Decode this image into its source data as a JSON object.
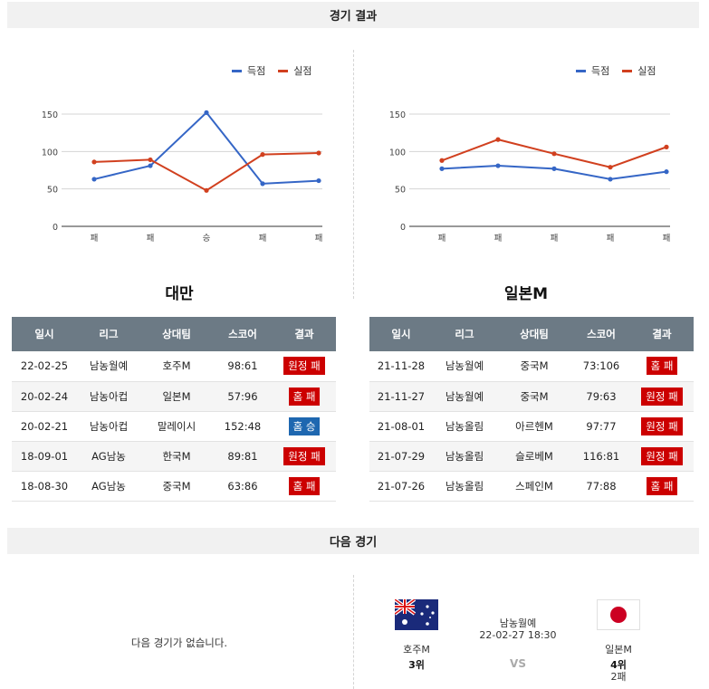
{
  "sections": {
    "results_title": "경기 결과",
    "next_title": "다음 경기"
  },
  "colors": {
    "scored": "#3566c6",
    "conceded": "#d1401f",
    "loss_badge": "#cc0000",
    "win_badge": "#1e67b0",
    "header_bg": "#6c7a85"
  },
  "legend": {
    "scored": "득점",
    "conceded": "실점"
  },
  "chart_data": [
    {
      "type": "line",
      "categories": [
        "패",
        "패",
        "승",
        "패",
        "패"
      ],
      "ylim": [
        0,
        150
      ],
      "yticks": [
        0,
        50,
        100,
        150
      ],
      "grid": true,
      "legend_position": "top-right",
      "series": [
        {
          "name": "득점",
          "values": [
            63,
            81,
            152,
            57,
            61
          ]
        },
        {
          "name": "실점",
          "values": [
            86,
            89,
            48,
            96,
            98
          ]
        }
      ]
    },
    {
      "type": "line",
      "categories": [
        "패",
        "패",
        "패",
        "패",
        "패"
      ],
      "ylim": [
        0,
        150
      ],
      "yticks": [
        0,
        50,
        100,
        150
      ],
      "grid": true,
      "legend_position": "top-right",
      "series": [
        {
          "name": "득점",
          "values": [
            77,
            81,
            77,
            63,
            73
          ]
        },
        {
          "name": "실점",
          "values": [
            88,
            116,
            97,
            79,
            106
          ]
        }
      ]
    }
  ],
  "teams": [
    {
      "name": "대만",
      "columns": [
        "일시",
        "리그",
        "상대팀",
        "스코어",
        "결과"
      ],
      "rows": [
        {
          "date": "22-02-25",
          "league": "남농월예",
          "opponent": "호주M",
          "score": "98:61",
          "result": "원정 패",
          "win": false
        },
        {
          "date": "20-02-24",
          "league": "남농아컵",
          "opponent": "일본M",
          "score": "57:96",
          "result": "홈 패",
          "win": false
        },
        {
          "date": "20-02-21",
          "league": "남농아컵",
          "opponent": "말레이시",
          "score": "152:48",
          "result": "홈 승",
          "win": true
        },
        {
          "date": "18-09-01",
          "league": "AG남농",
          "opponent": "한국M",
          "score": "89:81",
          "result": "원정 패",
          "win": false
        },
        {
          "date": "18-08-30",
          "league": "AG남농",
          "opponent": "중국M",
          "score": "63:86",
          "result": "홈 패",
          "win": false
        }
      ]
    },
    {
      "name": "일본M",
      "columns": [
        "일시",
        "리그",
        "상대팀",
        "스코어",
        "결과"
      ],
      "rows": [
        {
          "date": "21-11-28",
          "league": "남농월예",
          "opponent": "중국M",
          "score": "73:106",
          "result": "홈 패",
          "win": false
        },
        {
          "date": "21-11-27",
          "league": "남농월예",
          "opponent": "중국M",
          "score": "79:63",
          "result": "원정 패",
          "win": false
        },
        {
          "date": "21-08-01",
          "league": "남농올림",
          "opponent": "아르헨M",
          "score": "97:77",
          "result": "원정 패",
          "win": false
        },
        {
          "date": "21-07-29",
          "league": "남농올림",
          "opponent": "슬로베M",
          "score": "116:81",
          "result": "원정 패",
          "win": false
        },
        {
          "date": "21-07-26",
          "league": "남농올림",
          "opponent": "스페인M",
          "score": "77:88",
          "result": "홈 패",
          "win": false
        }
      ]
    }
  ],
  "next_game": {
    "no_game_text": "다음 경기가 없습니다.",
    "league": "남농월예",
    "datetime": "22-02-27 18:30",
    "vs": "VS",
    "home": {
      "name": "호주M",
      "rank": "3위",
      "flag_icon": "australia-flag-icon"
    },
    "away": {
      "name": "일본M",
      "rank": "4위",
      "record": "2패",
      "flag_icon": "japan-flag-icon"
    }
  }
}
